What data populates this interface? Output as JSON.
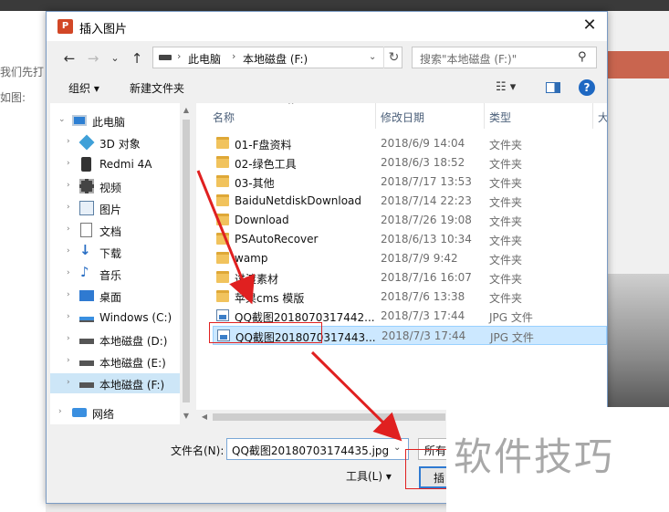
{
  "background": {
    "left_text_lines": [
      "我们先打",
      "如图:"
    ]
  },
  "dialog": {
    "title": "插入图片",
    "app_icon_letter": "P",
    "close_glyph": "✕"
  },
  "address": {
    "back_glyph": "←",
    "forward_glyph": "→",
    "dropdown_glyph": "⌄",
    "up_glyph": "↑",
    "crumbs": [
      "此电脑",
      "本地磁盘 (F:)"
    ],
    "chevron_glyph": "›",
    "refresh_glyph": "↻",
    "dropdown2_glyph": "⌄"
  },
  "search": {
    "placeholder": "搜索\"本地磁盘 (F:)\"",
    "icon_glyph": "⚲"
  },
  "toolbar": {
    "organize_label": "组织 ▾",
    "new_folder_label": "新建文件夹",
    "view_glyph": "☷ ▾",
    "help_glyph": "?"
  },
  "nav": {
    "items": [
      {
        "label": "此电脑",
        "icon": "pc-icon",
        "expanded": true
      },
      {
        "label": "3D 对象",
        "icon": "cube-icon"
      },
      {
        "label": "Redmi 4A",
        "icon": "phone-icon"
      },
      {
        "label": "视频",
        "icon": "video-icon"
      },
      {
        "label": "图片",
        "icon": "picture-icon"
      },
      {
        "label": "文档",
        "icon": "document-icon"
      },
      {
        "label": "下载",
        "icon": "download-icon"
      },
      {
        "label": "音乐",
        "icon": "music-icon"
      },
      {
        "label": "桌面",
        "icon": "desktop-icon"
      },
      {
        "label": "Windows (C:)",
        "icon": "drive-icon"
      },
      {
        "label": "本地磁盘 (D:)",
        "icon": "drive-icon"
      },
      {
        "label": "本地磁盘 (E:)",
        "icon": "drive-icon"
      },
      {
        "label": "本地磁盘 (F:)",
        "icon": "drive-icon",
        "selected": true
      },
      {
        "label": "网络",
        "icon": "network-icon"
      }
    ],
    "expand_glyph": "›",
    "expanded_glyph": "⌄"
  },
  "file_list": {
    "columns": [
      "名称",
      "修改日期",
      "类型",
      "大"
    ],
    "sort_glyph": "^",
    "rows": [
      {
        "name": "01-F盘资料",
        "date": "2018/6/9 14:04",
        "type": "文件夹",
        "kind": "folder"
      },
      {
        "name": "02-绿色工具",
        "date": "2018/6/3 18:52",
        "type": "文件夹",
        "kind": "folder"
      },
      {
        "name": "03-其他",
        "date": "2018/7/17 13:53",
        "type": "文件夹",
        "kind": "folder"
      },
      {
        "name": "BaiduNetdiskDownload",
        "date": "2018/7/14 22:23",
        "type": "文件夹",
        "kind": "folder"
      },
      {
        "name": "Download",
        "date": "2018/7/26 19:08",
        "type": "文件夹",
        "kind": "folder"
      },
      {
        "name": "PSAutoRecover",
        "date": "2018/6/13 10:34",
        "type": "文件夹",
        "kind": "folder"
      },
      {
        "name": "wamp",
        "date": "2018/7/9 9:42",
        "type": "文件夹",
        "kind": "folder"
      },
      {
        "name": "过渡素材",
        "date": "2018/7/16 16:07",
        "type": "文件夹",
        "kind": "folder"
      },
      {
        "name": "苹果cms 模版",
        "date": "2018/7/6 13:38",
        "type": "文件夹",
        "kind": "folder"
      },
      {
        "name": "QQ截图2018070317442...",
        "date": "2018/7/3 17:44",
        "type": "JPG 文件",
        "kind": "jpg"
      },
      {
        "name": "QQ截图2018070317443...",
        "date": "2018/7/3 17:44",
        "type": "JPG 文件",
        "kind": "jpg",
        "selected": true
      }
    ]
  },
  "bottom": {
    "filename_label": "文件名(N):",
    "filename_value": "QQ截图20180703174435.jpg",
    "filename_drop_glyph": "⌄",
    "filter_value": "所有",
    "tools_label": "工具(L)  ▾",
    "insert_label": "插"
  },
  "scroll": {
    "up_glyph": "▲",
    "down_glyph": "▼",
    "left_glyph": "◀"
  },
  "watermark": {
    "text": "软件技巧"
  },
  "colors": {
    "annotation_red": "#e02020",
    "selection_blue": "#cce8ff",
    "accent_blue": "#2f7ad1"
  }
}
